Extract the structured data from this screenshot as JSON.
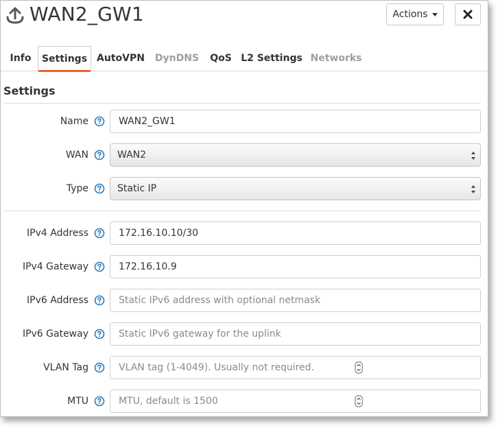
{
  "header": {
    "title": "WAN2_GW1",
    "actions_label": "Actions"
  },
  "tabs": [
    {
      "label": "Info",
      "state": "normal"
    },
    {
      "label": "Settings",
      "state": "active"
    },
    {
      "label": "AutoVPN",
      "state": "normal"
    },
    {
      "label": "DynDNS",
      "state": "disabled"
    },
    {
      "label": "QoS",
      "state": "normal"
    },
    {
      "label": "L2 Settings",
      "state": "normal"
    },
    {
      "label": "Networks",
      "state": "disabled"
    }
  ],
  "section": {
    "title": "Settings"
  },
  "form": {
    "name": {
      "label": "Name",
      "value": "WAN2_GW1"
    },
    "wan": {
      "label": "WAN",
      "value": "WAN2"
    },
    "type": {
      "label": "Type",
      "value": "Static IP"
    },
    "ipv4_address": {
      "label": "IPv4 Address",
      "value": "172.16.10.10/30"
    },
    "ipv4_gateway": {
      "label": "IPv4 Gateway",
      "value": "172.16.10.9"
    },
    "ipv6_address": {
      "label": "IPv6 Address",
      "value": "",
      "placeholder": "Static IPv6 address with optional netmask"
    },
    "ipv6_gateway": {
      "label": "IPv6 Gateway",
      "value": "",
      "placeholder": "Static IPv6 gateway for the uplink"
    },
    "vlan_tag": {
      "label": "VLAN Tag",
      "value": "",
      "placeholder": "VLAN tag (1-4049). Usually not required."
    },
    "mtu": {
      "label": "MTU",
      "value": "",
      "placeholder": "MTU, default is 1500"
    }
  },
  "icons": {
    "title": "uplink-icon",
    "help": "help-circle-icon",
    "close": "close-icon",
    "dropdown": "caret-down-icon",
    "select": "select-arrows-icon",
    "spinner": "spinner-arrows-icon"
  },
  "colors": {
    "active_tab_underline": "#f0632a",
    "help_icon": "#2b7bb9",
    "disabled_tab": "#9aa0a0",
    "text": "#333333"
  }
}
